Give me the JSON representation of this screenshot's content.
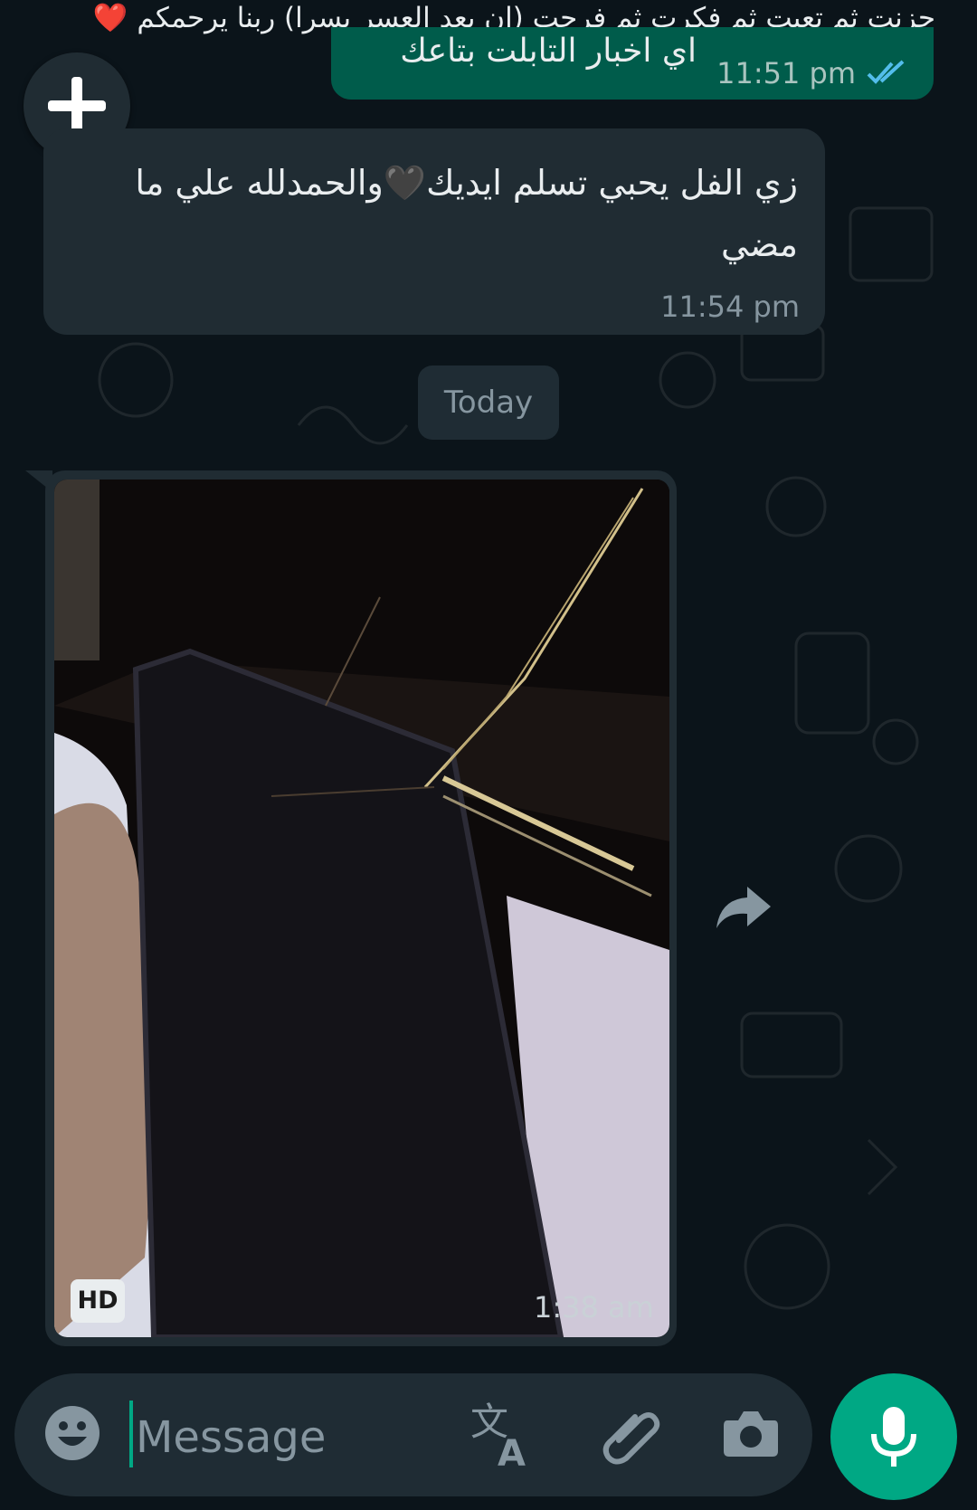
{
  "status_caption": {
    "text": "حزنت ثم تعبت ثم فكرت ثم فرحت (إن بعد العسر يسرا) ربنا يرحمكم",
    "emoji": "❤️"
  },
  "messages": [
    {
      "direction": "outgoing",
      "text": "اي اخبار التابلت بتاعك",
      "time": "11:51 pm",
      "status": "read"
    },
    {
      "direction": "incoming",
      "text_before_emoji": "زي الفل يحبي تسلم ايديك",
      "emoji": "🖤",
      "text_after_emoji": "والحمدلله علي ما مضي",
      "time": "11:54 pm"
    },
    {
      "direction": "incoming",
      "type": "image",
      "badge": "HD",
      "time": "1:38 am"
    }
  ],
  "date_divider": "Today",
  "input_bar": {
    "placeholder": "Message",
    "icons": [
      "emoji-icon",
      "translate-icon",
      "paperclip-icon",
      "camera-icon",
      "microphone-icon"
    ]
  },
  "colors": {
    "background": "#0b141a",
    "outgoing_bubble": "#005c4b",
    "incoming_bubble": "#202c33",
    "accent": "#00a884",
    "read_ticks": "#53bdeb"
  }
}
